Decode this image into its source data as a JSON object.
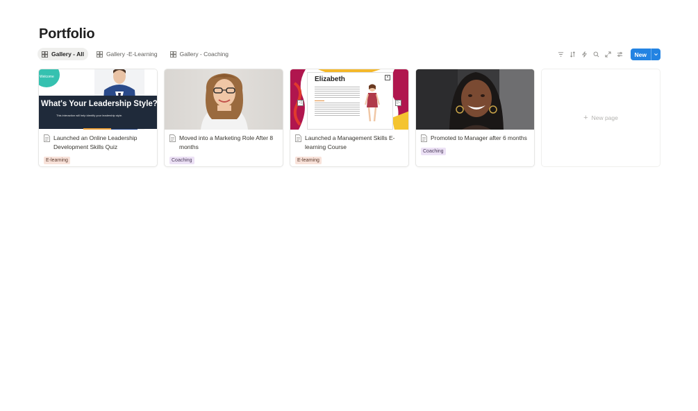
{
  "page": {
    "title": "Portfolio"
  },
  "tabs": [
    {
      "label": "Gallery - All",
      "active": true
    },
    {
      "label": "Gallery -E-Learning",
      "active": false
    },
    {
      "label": "Gallery - Coaching",
      "active": false
    }
  ],
  "toolbar": {
    "icons": [
      "filter-icon",
      "sort-icon",
      "lightning-icon",
      "search-icon",
      "expand-icon",
      "settings-sliders-icon"
    ],
    "new_label": "New"
  },
  "cards": [
    {
      "title": "Launched an Online Leadership Development Skills Quiz",
      "tag": "E-learning",
      "cover": {
        "headline": "What's Your Leadership Style?",
        "subtitle": "This interaction will help identify your leadership style.",
        "badge": "Welcome"
      }
    },
    {
      "title": "Moved into a Marketing Role After 8 months",
      "tag": "Coaching"
    },
    {
      "title": "Launched a Management Skills E-learning Course",
      "tag": "E-learning",
      "cover": {
        "doc_title": "Elizabeth"
      }
    },
    {
      "title": "Promoted to Manager after 6 months",
      "tag": "Coaching"
    }
  ],
  "new_page_label": "New page",
  "colors": {
    "accent": "#2383e2",
    "tag_elearning": "#f8e2da",
    "tag_coaching": "#ece1f5"
  }
}
